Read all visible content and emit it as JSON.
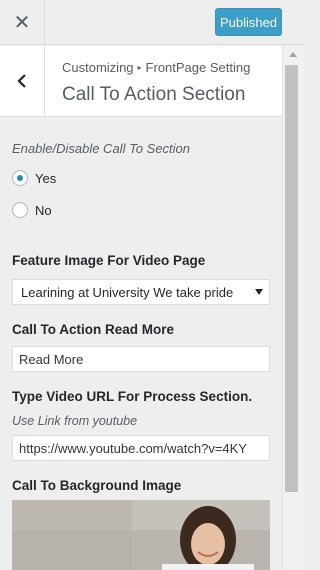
{
  "topbar": {
    "close_icon": "close-icon",
    "publish_label": "Published",
    "publish_color": "#0085ba"
  },
  "header": {
    "back_icon": "chevron-left-icon",
    "breadcrumb_root": "Customizing",
    "breadcrumb_separator": "▸",
    "breadcrumb_parent": "FrontPage Setting",
    "title": "Call To Action Section"
  },
  "controls": {
    "enable_label": "Enable/Disable Call To Section",
    "radio_yes": "Yes",
    "radio_no": "No",
    "radio_selected": "Yes",
    "feature_image_title": "Feature Image For Video Page",
    "feature_image_selected": "Learining at University We take pride",
    "read_more_title": "Call To Action Read More",
    "read_more_value": "Read More",
    "video_url_title": "Type Video URL For Process Section.",
    "video_url_desc": "Use Link from youtube",
    "video_url_value": "https://www.youtube.com/watch?v=4KY",
    "background_image_title": "Call To Background Image"
  },
  "accent_color": "#1e8cbe"
}
